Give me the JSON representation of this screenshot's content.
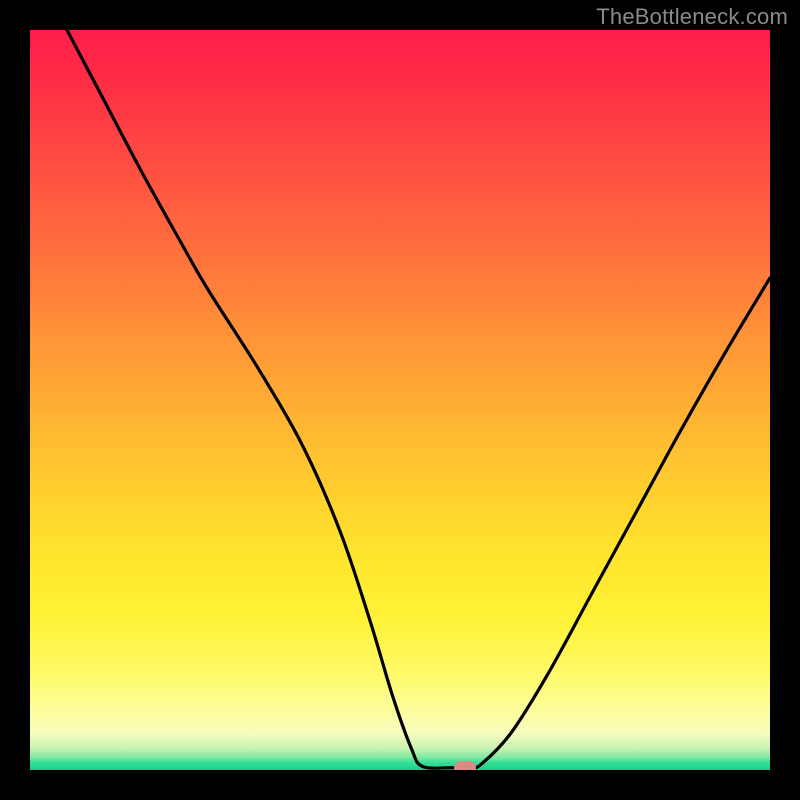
{
  "watermark": "TheBottleneck.com",
  "chart_data": {
    "type": "line",
    "title": "",
    "xlabel": "",
    "ylabel": "",
    "xlim": [
      0,
      100
    ],
    "ylim": [
      0,
      100
    ],
    "grid": false,
    "legend": false,
    "curve": [
      {
        "x": 5.0,
        "y": 100.0
      },
      {
        "x": 10.0,
        "y": 90.5
      },
      {
        "x": 15.0,
        "y": 81.0
      },
      {
        "x": 20.0,
        "y": 72.0
      },
      {
        "x": 24.0,
        "y": 65.0
      },
      {
        "x": 31.0,
        "y": 54.0
      },
      {
        "x": 37.0,
        "y": 43.5
      },
      {
        "x": 42.0,
        "y": 32.0
      },
      {
        "x": 46.0,
        "y": 20.0
      },
      {
        "x": 49.0,
        "y": 10.0
      },
      {
        "x": 51.5,
        "y": 3.0
      },
      {
        "x": 53.0,
        "y": 0.5
      },
      {
        "x": 57.0,
        "y": 0.3
      },
      {
        "x": 59.5,
        "y": 0.3
      },
      {
        "x": 61.0,
        "y": 0.8
      },
      {
        "x": 65.0,
        "y": 5.0
      },
      {
        "x": 70.0,
        "y": 13.0
      },
      {
        "x": 76.0,
        "y": 24.0
      },
      {
        "x": 82.0,
        "y": 35.0
      },
      {
        "x": 88.0,
        "y": 46.0
      },
      {
        "x": 94.0,
        "y": 56.5
      },
      {
        "x": 100.0,
        "y": 66.5
      }
    ],
    "minimum_marker": {
      "x": 58.8,
      "y": 0.3,
      "color": "#d98a85"
    },
    "curve_stroke": "#000000",
    "curve_stroke_width": 3.2,
    "background_gradient_stops": [
      {
        "pos": 0.0,
        "color": "#ff1d4a"
      },
      {
        "pos": 0.28,
        "color": "#ff6a3e"
      },
      {
        "pos": 0.52,
        "color": "#ffb233"
      },
      {
        "pos": 0.8,
        "color": "#fff238"
      },
      {
        "pos": 0.95,
        "color": "#f7fbbf"
      },
      {
        "pos": 0.99,
        "color": "#36dd96"
      },
      {
        "pos": 1.0,
        "color": "#18d38d"
      }
    ]
  }
}
